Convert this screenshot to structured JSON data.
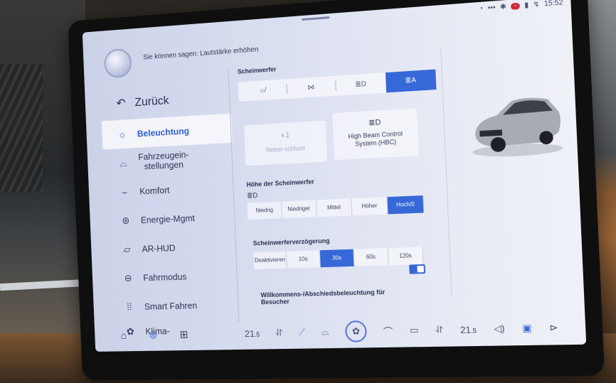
{
  "status": {
    "time": "15:52",
    "badge": "~"
  },
  "voice_hint": "Sie können sagen: Lautstärke erhöhen",
  "back_label": "Zurück",
  "sidebar": {
    "items": [
      {
        "label": "Beleuchtung",
        "icon": "light-icon"
      },
      {
        "label": "Fahrzeugein-\nstellungen",
        "icon": "car-icon"
      },
      {
        "label": "Komfort",
        "icon": "seat-icon"
      },
      {
        "label": "Energie-Mgmt",
        "icon": "energy-icon"
      },
      {
        "label": "AR-HUD",
        "icon": "hud-icon"
      },
      {
        "label": "Fahrmodus",
        "icon": "steering-icon"
      },
      {
        "label": "Smart Fahren",
        "icon": "assist-icon"
      },
      {
        "label": "Klima-",
        "icon": "climate-icon"
      }
    ]
  },
  "headlights": {
    "title": "Scheinwerfer",
    "fog_label": "Nebel-schluss",
    "hbc_label": "High Beam Control System (HBC)"
  },
  "height": {
    "title": "Höhe der Scheinwerfer",
    "options": [
      "Niedrig",
      "Niedriger",
      "Mittel",
      "Höher",
      "Hoch/0"
    ],
    "selected": 4
  },
  "delay": {
    "title": "Scheinwerferverzögerung",
    "options": [
      "Deaktivieren",
      "10s",
      "30s",
      "60s",
      "120s"
    ],
    "selected": 2
  },
  "welcome": {
    "title": "Willkommens-/Abschiedsbeleuchtung für",
    "sub": "Besucher"
  },
  "dock": {
    "temp_left": "21",
    "temp_left_dec": ".5",
    "temp_right": "21",
    "temp_right_dec": ".5"
  }
}
